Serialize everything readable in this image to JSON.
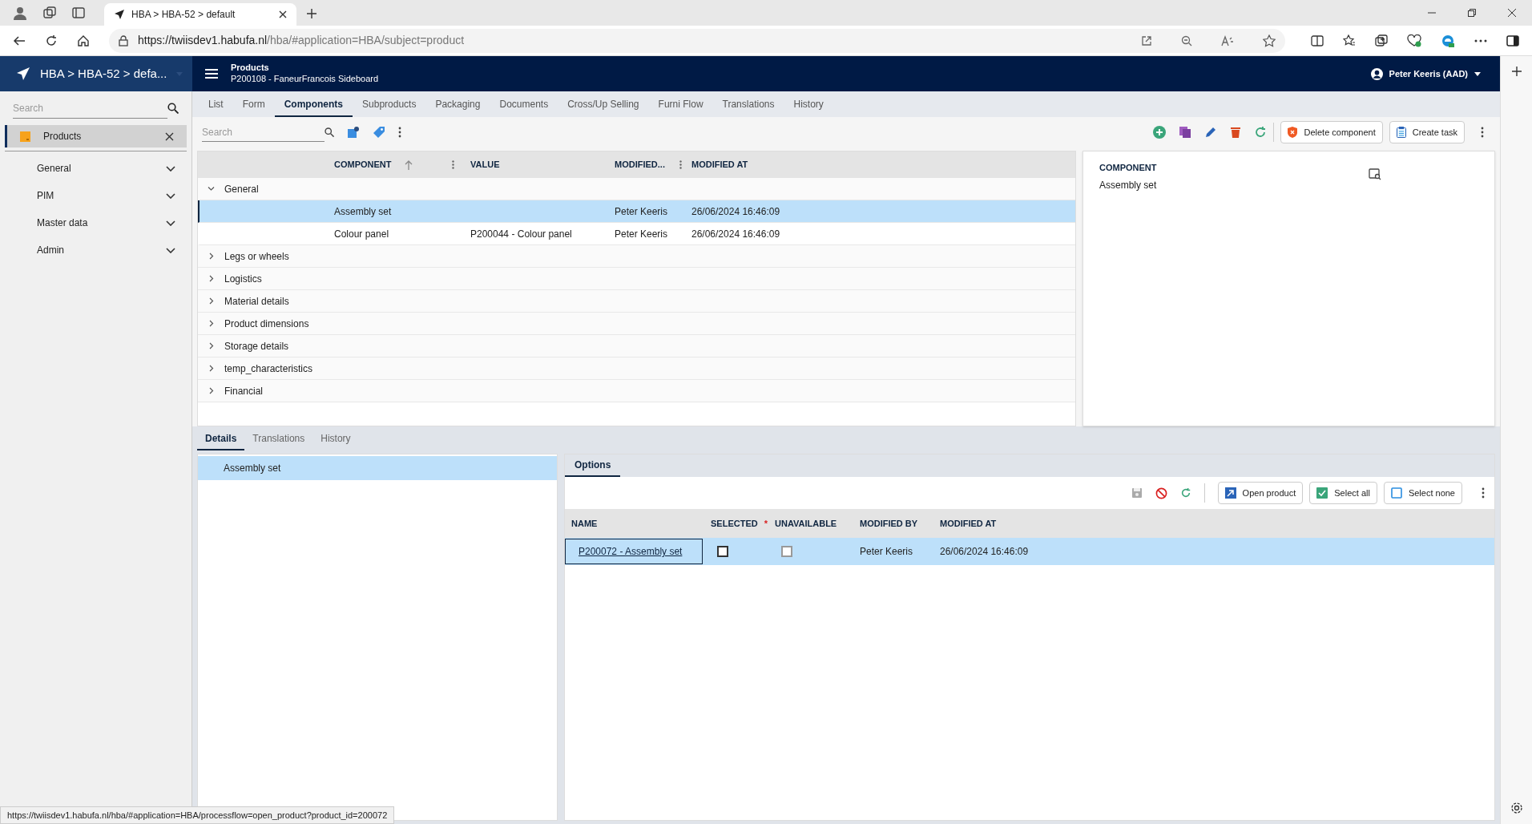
{
  "browser": {
    "tab_title": "HBA > HBA-52 > default",
    "url_host": "https://twiisdev1.habufa.nl",
    "url_path": "/hba/#application=HBA/subject=product",
    "status_url": "https://twiisdev1.habufa.nl/hba/#application=HBA/processflow=open_product?product_id=200072"
  },
  "app": {
    "title": "HBA > HBA-52 > defa...",
    "header_title": "Products",
    "header_subtitle": "P200108 - FaneurFrancois Sideboard",
    "user": "Peter Keeris (AAD)"
  },
  "sidebar": {
    "search": {
      "placeholder": "Search"
    },
    "open_item": "Products",
    "items": [
      {
        "label": "General",
        "expanded": false
      },
      {
        "label": "PIM",
        "expanded": false
      },
      {
        "label": "Master data",
        "expanded": false
      },
      {
        "label": "Admin",
        "expanded": false
      }
    ]
  },
  "tabs": [
    {
      "label": "List",
      "selected": false
    },
    {
      "label": "Form",
      "selected": false
    },
    {
      "label": "Components",
      "selected": true
    },
    {
      "label": "Subproducts",
      "selected": false
    },
    {
      "label": "Packaging",
      "selected": false
    },
    {
      "label": "Documents",
      "selected": false
    },
    {
      "label": "Cross/Up Selling",
      "selected": false
    },
    {
      "label": "Furni Flow",
      "selected": false
    },
    {
      "label": "Translations",
      "selected": false
    },
    {
      "label": "History",
      "selected": false
    }
  ],
  "toolbar": {
    "search": {
      "placeholder": "Search"
    },
    "buttons": [
      "Delete component",
      "Create task"
    ]
  },
  "grid": {
    "columns": [
      "COMPONENT",
      "VALUE",
      "MODIFIED...",
      "MODIFIED AT"
    ],
    "groups": [
      {
        "label": "General",
        "expanded": true,
        "rows": [
          {
            "component": "Assembly set",
            "value": "",
            "modified_by": "Peter Keeris",
            "modified_at": "26/06/2024 16:46:09",
            "selected": true
          },
          {
            "component": "Colour panel",
            "value": "P200044 - Colour panel",
            "modified_by": "Peter Keeris",
            "modified_at": "26/06/2024 16:46:09",
            "selected": false
          }
        ]
      },
      {
        "label": "Legs or wheels",
        "expanded": false
      },
      {
        "label": "Logistics",
        "expanded": false
      },
      {
        "label": "Material details",
        "expanded": false
      },
      {
        "label": "Product dimensions",
        "expanded": false
      },
      {
        "label": "Storage details",
        "expanded": false
      },
      {
        "label": "temp_characteristics",
        "expanded": false
      },
      {
        "label": "Financial",
        "expanded": false
      }
    ]
  },
  "detail": {
    "label": "COMPONENT",
    "value": "Assembly set"
  },
  "bottom_tabs": [
    {
      "label": "Details",
      "selected": true
    },
    {
      "label": "Translations",
      "selected": false
    },
    {
      "label": "History",
      "selected": false
    }
  ],
  "detail_list": [
    {
      "label": "Assembly set",
      "selected": true
    }
  ],
  "options": {
    "tab": "Options",
    "buttons": [
      "Open product",
      "Select all",
      "Select none"
    ],
    "columns": [
      "NAME",
      "SELECTED",
      "UNAVAILABLE",
      "MODIFIED BY",
      "MODIFIED AT"
    ],
    "required_mark": "*",
    "rows": [
      {
        "name": "P200072 - Assembly set",
        "checked": false,
        "unavailable": false,
        "modified_by": "Peter Keeris",
        "modified_at": "26/06/2024 16:46:09",
        "selected": true
      }
    ]
  }
}
